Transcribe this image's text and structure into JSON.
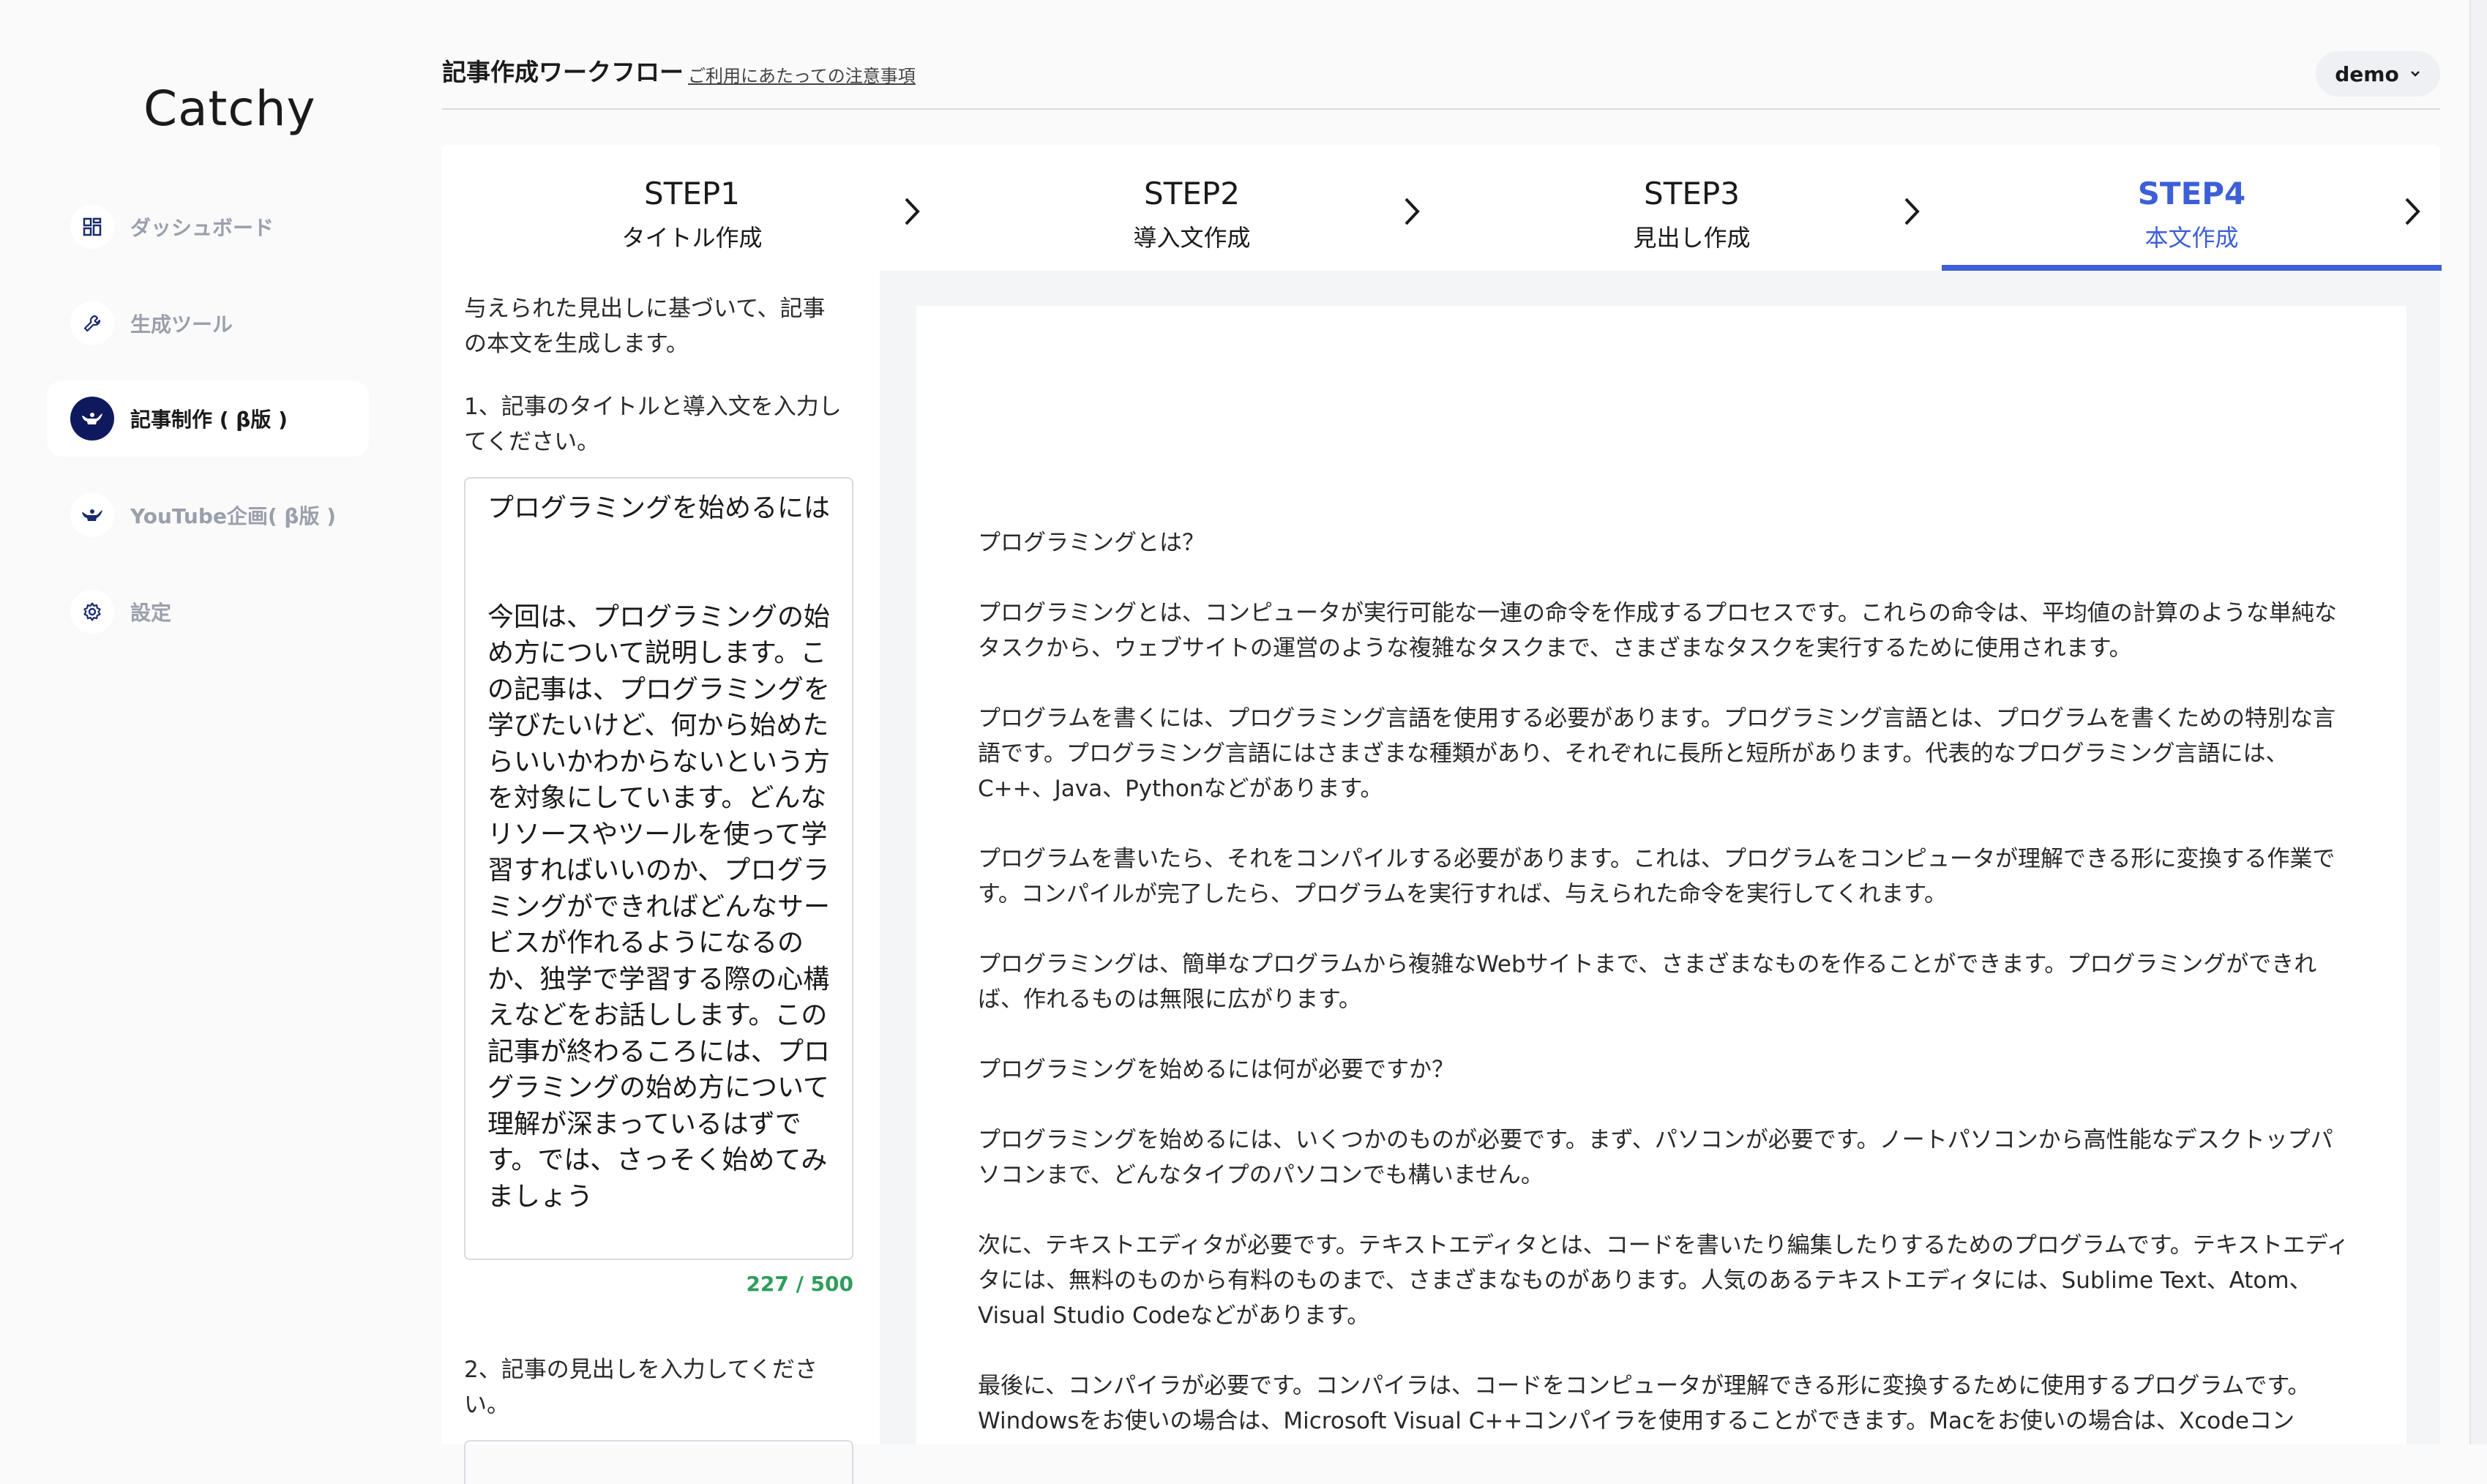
{
  "app": {
    "logo": "Catchy"
  },
  "sidebar": {
    "items": [
      {
        "label": "ダッシュボード",
        "icon": "dashboard-grid-icon"
      },
      {
        "label": "生成ツール",
        "icon": "wrench-icon"
      },
      {
        "label": "記事制作 ( β版 )",
        "icon": "genie-lamp-icon"
      },
      {
        "label": "YouTube企画( β版 )",
        "icon": "genie-lamp-icon"
      },
      {
        "label": "設定",
        "icon": "gear-icon"
      }
    ]
  },
  "header": {
    "title": "記事作成ワークフロー",
    "notice_link": "ご利用にあたっての注意事項",
    "user": "demo"
  },
  "steps": [
    {
      "num": "STEP1",
      "label": "タイトル作成"
    },
    {
      "num": "STEP2",
      "label": "導入文作成"
    },
    {
      "num": "STEP3",
      "label": "見出し作成"
    },
    {
      "num": "STEP4",
      "label": "本文作成"
    }
  ],
  "colors": {
    "accent": "#3d5fd8",
    "counter": "#2e9d5b",
    "nav_active_icon_bg": "#0f1a5e"
  },
  "left": {
    "description": "与えられた見出しに基づいて、記事の本文を生成します。",
    "q1": "1、記事のタイトルと導入文を入力してください。",
    "input_text": "プログラミングを始めるには\n\n\n今回は、プログラミングの始め方について説明します。この記事は、プログラミングを学びたいけど、何から始めたらいいかわからないという方を対象にしています。どんなリソースやツールを使って学習すればいいのか、プログラミングができればどんなサービスが作れるようになるのか、独学で学習する際の心構えなどをお話しします。この記事が終わるころには、プログラミングの始め方について理解が深まっているはずです。では、さっそく始めてみましょう",
    "counter": "227 / 500",
    "q2": "2、記事の見出しを入力してください。"
  },
  "article": {
    "paragraphs": [
      "プログラミングとは？",
      "プログラミングとは、コンピュータが実行可能な一連の命令を作成するプロセスです。これらの命令は、平均値の計算のような単純なタスクから、ウェブサイトの運営のような複雑なタスクまで、さまざまなタスクを実行するために使用されます。",
      "プログラムを書くには、プログラミング言語を使用する必要があります。プログラミング言語とは、プログラムを書くための特別な言語です。プログラミング言語にはさまざまな種類があり、それぞれに長所と短所があります。代表的なプログラミング言語には、C++、Java、Pythonなどがあります。",
      "プログラムを書いたら、それをコンパイルする必要があります。これは、プログラムをコンピュータが理解できる形に変換する作業です。コンパイルが完了したら、プログラムを実行すれば、与えられた命令を実行してくれます。",
      "プログラミングは、簡単なプログラムから複雑なWebサイトまで、さまざまなものを作ることができます。プログラミングができれば、作れるものは無限に広がります。",
      "プログラミングを始めるには何が必要ですか？",
      "プログラミングを始めるには、いくつかのものが必要です。まず、パソコンが必要です。ノートパソコンから高性能なデスクトップパソコンまで、どんなタイプのパソコンでも構いません。",
      "次に、テキストエディタが必要です。テキストエディタとは、コードを書いたり編集したりするためのプログラムです。テキストエディタには、無料のものから有料のものまで、さまざまなものがあります。人気のあるテキストエディタには、Sublime Text、Atom、Visual Studio Codeなどがあります。",
      "最後に、コンパイラが必要です。コンパイラは、コードをコンピュータが理解できる形に変換するために使用するプログラムです。Windowsをお使いの場合は、Microsoft Visual C++コンパイラを使用することができます。Macをお使いの場合は、Xcodeコン"
    ]
  }
}
